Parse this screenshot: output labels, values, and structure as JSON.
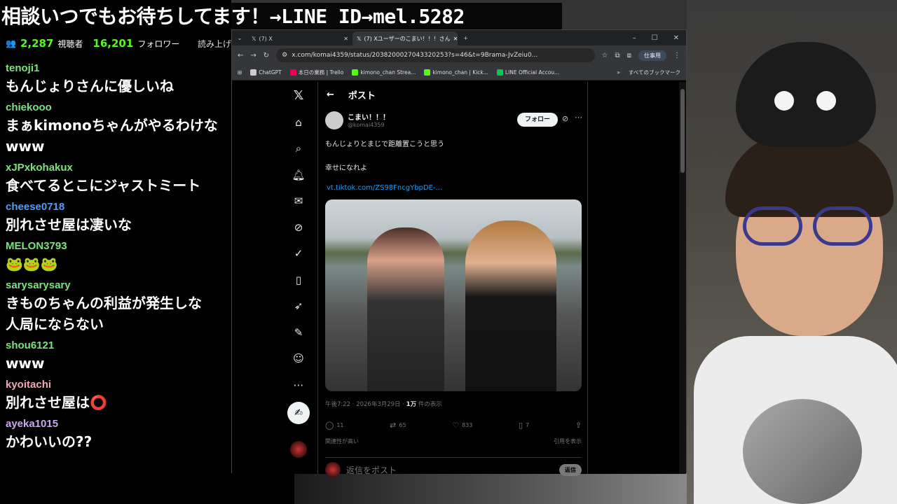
{
  "banner": "相談いつでもお待ちしてます！→LINE ID→mel.5282",
  "stats": {
    "viewers": "2,287",
    "viewers_label": "視聴者",
    "followers": "16,201",
    "followers_label": "フォロワー",
    "cut_label": "読み上げ"
  },
  "chat": [
    {
      "user": "tenoji1",
      "color": "#7be37b",
      "text": "もんじょりさんに優しいね"
    },
    {
      "user": "chiekooo",
      "color": "#7be37b",
      "text": "まぁkimonoちゃんがやるわけな\nwww"
    },
    {
      "user": "xJPxkohakux",
      "color": "#7be37b",
      "text": "食べてるとこにジャストミート"
    },
    {
      "user": "cheese0718",
      "color": "#4a9ff5",
      "text": "別れさせ屋は凄いな"
    },
    {
      "user": "MELON3793",
      "color": "#7be37b",
      "text": "🐸🐸🐸"
    },
    {
      "user": "sarysarysary",
      "color": "#7be37b",
      "text": "きものちゃんの利益が発生しな\n人局にならない"
    },
    {
      "user": "shou6121",
      "color": "#7be37b",
      "text": "www"
    },
    {
      "user": "kyoitachi",
      "color": "#f2a7b8",
      "text": "別れさせ屋は⭕"
    },
    {
      "user": "ayeka1015",
      "color": "#c9a7f2",
      "text": "かわいいの??"
    }
  ],
  "browser": {
    "tabs": [
      {
        "label": "(7) X"
      },
      {
        "label": "(7) Xユーザーのこまい！！！さん"
      }
    ],
    "url": "x.com/komai4359/status/2038200027043320253?s=46&t=9Brama-JvZeiu0...",
    "profile": "仕事用",
    "bookmarks": [
      {
        "label": "ChatGPT",
        "color": "#ccc"
      },
      {
        "label": "本日の業務 | Trello",
        "color": "#e05"
      },
      {
        "label": "kimono_chan Strea...",
        "color": "#53fc18"
      },
      {
        "label": "kimono_chan | Kick...",
        "color": "#53fc18"
      },
      {
        "label": "LINE Official Accou...",
        "color": "#06c755"
      }
    ],
    "bookmarks_all": "すべてのブックマーク"
  },
  "x": {
    "header": "ポスト",
    "author_name": "こまい！！！",
    "author_handle": "@komai4359",
    "follow_label": "フォロー",
    "line1": "もんじょりとまじで距離置こうと思う",
    "line2": "幸せになれよ",
    "link": "vt.tiktok.com/ZS98FncgYbpDE-...",
    "meta_time": "午後7:22 · 2026年3月29日 · ",
    "meta_views": "1万",
    "meta_views_label": " 件の表示",
    "replies": "11",
    "reposts": "65",
    "likes": "833",
    "bookmarks": "7",
    "relevance": "関連性が高い",
    "quotes": "引用を表示",
    "reply_placeholder": "返信をポスト",
    "reply_button": "返信"
  }
}
